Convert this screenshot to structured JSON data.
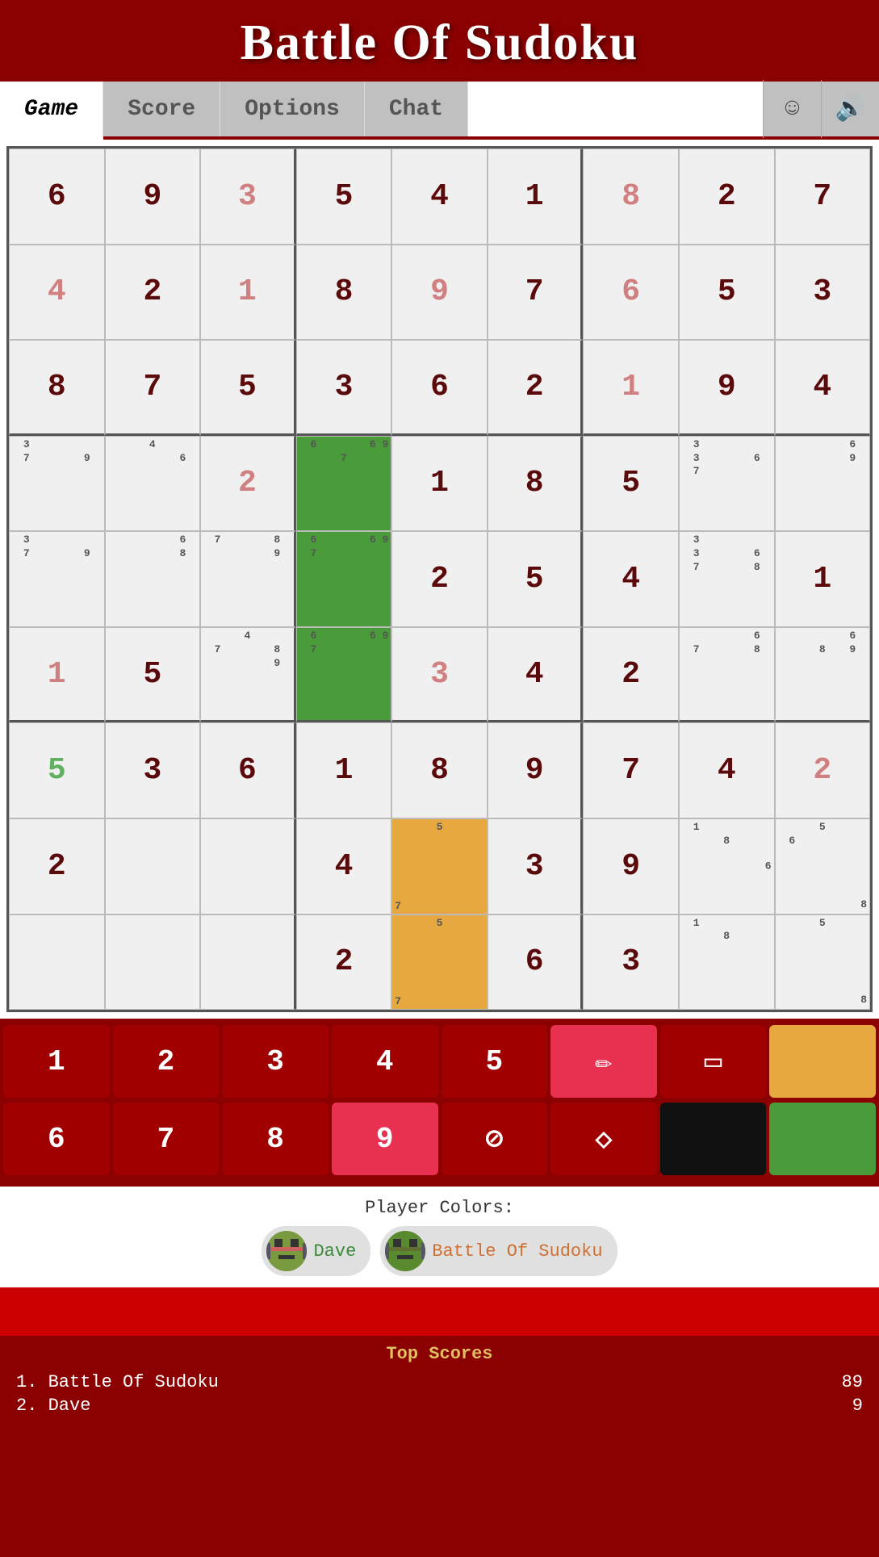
{
  "header": {
    "title": "Battle Of Sudoku"
  },
  "nav": {
    "tabs": [
      "Game",
      "Score",
      "Options",
      "Chat"
    ],
    "active_tab": "Game"
  },
  "grid": {
    "cells": [
      {
        "row": 0,
        "col": 0,
        "value": "6",
        "type": "fixed"
      },
      {
        "row": 0,
        "col": 1,
        "value": "9",
        "type": "fixed"
      },
      {
        "row": 0,
        "col": 2,
        "value": "3",
        "type": "player",
        "color": "pink"
      },
      {
        "row": 0,
        "col": 3,
        "value": "5",
        "type": "fixed"
      },
      {
        "row": 0,
        "col": 4,
        "value": "4",
        "type": "fixed"
      },
      {
        "row": 0,
        "col": 5,
        "value": "1",
        "type": "fixed"
      },
      {
        "row": 0,
        "col": 6,
        "value": "8",
        "type": "player",
        "color": "pink"
      },
      {
        "row": 0,
        "col": 7,
        "value": "2",
        "type": "fixed"
      },
      {
        "row": 0,
        "col": 8,
        "value": "7",
        "type": "fixed"
      },
      {
        "row": 1,
        "col": 0,
        "value": "4",
        "type": "player",
        "color": "pink"
      },
      {
        "row": 1,
        "col": 1,
        "value": "2",
        "type": "fixed"
      },
      {
        "row": 1,
        "col": 2,
        "value": "1",
        "type": "player",
        "color": "pink"
      },
      {
        "row": 1,
        "col": 3,
        "value": "8",
        "type": "fixed"
      },
      {
        "row": 1,
        "col": 4,
        "value": "9",
        "type": "player",
        "color": "pink"
      },
      {
        "row": 1,
        "col": 5,
        "value": "7",
        "type": "fixed"
      },
      {
        "row": 1,
        "col": 6,
        "value": "6",
        "type": "player",
        "color": "pink"
      },
      {
        "row": 1,
        "col": 7,
        "value": "5",
        "type": "fixed"
      },
      {
        "row": 1,
        "col": 8,
        "value": "3",
        "type": "fixed"
      },
      {
        "row": 2,
        "col": 0,
        "value": "8",
        "type": "fixed"
      },
      {
        "row": 2,
        "col": 1,
        "value": "7",
        "type": "fixed"
      },
      {
        "row": 2,
        "col": 2,
        "value": "5",
        "type": "fixed"
      },
      {
        "row": 2,
        "col": 3,
        "value": "3",
        "type": "fixed"
      },
      {
        "row": 2,
        "col": 4,
        "value": "6",
        "type": "fixed"
      },
      {
        "row": 2,
        "col": 5,
        "value": "2",
        "type": "fixed"
      },
      {
        "row": 2,
        "col": 6,
        "value": "1",
        "type": "player",
        "color": "pink"
      },
      {
        "row": 2,
        "col": 7,
        "value": "9",
        "type": "fixed"
      },
      {
        "row": 2,
        "col": 8,
        "value": "4",
        "type": "fixed"
      },
      {
        "row": 3,
        "col": 0,
        "value": "",
        "type": "notes",
        "notes": [
          "3",
          "",
          "",
          "7",
          "",
          "9",
          "",
          "",
          ""
        ]
      },
      {
        "row": 3,
        "col": 1,
        "value": "",
        "type": "notes",
        "notes": [
          "",
          "4",
          "",
          "",
          "",
          "6",
          "",
          "",
          ""
        ]
      },
      {
        "row": 3,
        "col": 2,
        "value": "2",
        "type": "player",
        "color": "pink"
      },
      {
        "row": 3,
        "col": 3,
        "value": "",
        "type": "notes",
        "bg": "green",
        "notes": [
          "",
          "",
          "",
          "6",
          "",
          "",
          "",
          "7",
          ""
        ],
        "topnotes": "6 9"
      },
      {
        "row": 3,
        "col": 4,
        "value": "1",
        "type": "fixed"
      },
      {
        "row": 3,
        "col": 5,
        "value": "8",
        "type": "fixed"
      },
      {
        "row": 3,
        "col": 6,
        "value": "5",
        "type": "fixed"
      },
      {
        "row": 3,
        "col": 7,
        "value": "",
        "type": "notes",
        "notes": [
          "3",
          "",
          "",
          "3",
          "",
          "6",
          "7",
          "",
          ""
        ]
      },
      {
        "row": 3,
        "col": 8,
        "value": "",
        "type": "notes",
        "notes": [
          "",
          "",
          "",
          "",
          "",
          "6",
          "",
          "",
          "9"
        ]
      },
      {
        "row": 4,
        "col": 0,
        "value": "",
        "type": "notes",
        "notes": [
          "3",
          "",
          "",
          "7",
          "",
          "9",
          "",
          "",
          ""
        ]
      },
      {
        "row": 4,
        "col": 1,
        "value": "",
        "type": "notes",
        "notes": [
          "",
          "",
          "",
          "",
          "",
          "6",
          "",
          "",
          "8"
        ]
      },
      {
        "row": 4,
        "col": 2,
        "value": "",
        "type": "notes",
        "notes": [
          "",
          "",
          "",
          "7",
          "",
          "8",
          "",
          "",
          "9"
        ]
      },
      {
        "row": 4,
        "col": 3,
        "value": "",
        "type": "notes",
        "bg": "green",
        "notes": [
          "",
          "",
          "",
          "6",
          "",
          "",
          "7",
          "",
          ""
        ],
        "topnotes": "6 9"
      },
      {
        "row": 4,
        "col": 4,
        "value": "2",
        "type": "fixed"
      },
      {
        "row": 4,
        "col": 5,
        "value": "5",
        "type": "fixed"
      },
      {
        "row": 4,
        "col": 6,
        "value": "4",
        "type": "fixed"
      },
      {
        "row": 4,
        "col": 7,
        "value": "",
        "type": "notes",
        "notes": [
          "3",
          "",
          "",
          "3",
          "",
          "6",
          "7",
          "",
          "8"
        ]
      },
      {
        "row": 4,
        "col": 8,
        "value": "1",
        "type": "fixed"
      },
      {
        "row": 5,
        "col": 0,
        "value": "1",
        "type": "player",
        "color": "pink"
      },
      {
        "row": 5,
        "col": 1,
        "value": "5",
        "type": "fixed"
      },
      {
        "row": 5,
        "col": 2,
        "value": "",
        "type": "notes",
        "notes": [
          "",
          "4",
          "",
          "7",
          "",
          "8",
          "",
          "",
          "9"
        ]
      },
      {
        "row": 5,
        "col": 3,
        "value": "",
        "type": "notes",
        "bg": "green",
        "notes": [
          "",
          "",
          "",
          "6",
          "",
          "",
          "7",
          "",
          ""
        ],
        "topnotes": "6 9"
      },
      {
        "row": 5,
        "col": 4,
        "value": "3",
        "type": "player",
        "color": "pink"
      },
      {
        "row": 5,
        "col": 5,
        "value": "4",
        "type": "fixed"
      },
      {
        "row": 5,
        "col": 6,
        "value": "2",
        "type": "fixed"
      },
      {
        "row": 5,
        "col": 7,
        "value": "",
        "type": "notes",
        "notes": [
          "",
          "",
          "",
          "",
          "",
          "6",
          "7",
          "",
          "8"
        ]
      },
      {
        "row": 5,
        "col": 8,
        "value": "",
        "type": "notes",
        "notes": [
          "",
          "",
          "",
          "",
          "",
          "6",
          "",
          "8",
          "9"
        ]
      },
      {
        "row": 6,
        "col": 0,
        "value": "5",
        "type": "player",
        "color": "green"
      },
      {
        "row": 6,
        "col": 1,
        "value": "3",
        "type": "fixed"
      },
      {
        "row": 6,
        "col": 2,
        "value": "6",
        "type": "fixed"
      },
      {
        "row": 6,
        "col": 3,
        "value": "1",
        "type": "fixed"
      },
      {
        "row": 6,
        "col": 4,
        "value": "8",
        "type": "fixed"
      },
      {
        "row": 6,
        "col": 5,
        "value": "9",
        "type": "fixed"
      },
      {
        "row": 6,
        "col": 6,
        "value": "7",
        "type": "fixed"
      },
      {
        "row": 6,
        "col": 7,
        "value": "4",
        "type": "fixed"
      },
      {
        "row": 6,
        "col": 8,
        "value": "2",
        "type": "player",
        "color": "pink"
      },
      {
        "row": 7,
        "col": 0,
        "value": "2",
        "type": "fixed"
      },
      {
        "row": 7,
        "col": 1,
        "value": "",
        "type": "empty"
      },
      {
        "row": 7,
        "col": 2,
        "value": "",
        "type": "empty"
      },
      {
        "row": 7,
        "col": 3,
        "value": "4",
        "type": "fixed"
      },
      {
        "row": 7,
        "col": 4,
        "value": "",
        "type": "notes",
        "bg": "orange",
        "notes": [
          "",
          "",
          "",
          "",
          "5",
          "",
          "",
          "",
          ""
        ],
        "botnotes": "7"
      },
      {
        "row": 7,
        "col": 5,
        "value": "3",
        "type": "fixed"
      },
      {
        "row": 7,
        "col": 6,
        "value": "9",
        "type": "fixed"
      },
      {
        "row": 7,
        "col": 7,
        "value": "",
        "type": "notes",
        "notes": [
          "1",
          "",
          "",
          "",
          "",
          "",
          "",
          "8",
          ""
        ],
        "side": "6"
      },
      {
        "row": 7,
        "col": 8,
        "value": "",
        "type": "notes",
        "notes": [
          "",
          "",
          "",
          "",
          "5",
          "",
          "6",
          "",
          ""
        ],
        "side2": "8"
      },
      {
        "row": 8,
        "col": 0,
        "value": "",
        "type": "empty"
      },
      {
        "row": 8,
        "col": 1,
        "value": "",
        "type": "empty"
      },
      {
        "row": 8,
        "col": 2,
        "value": "",
        "type": "empty"
      },
      {
        "row": 8,
        "col": 3,
        "value": "2",
        "type": "fixed"
      },
      {
        "row": 8,
        "col": 4,
        "value": "",
        "type": "notes",
        "bg": "orange",
        "notes": [
          "",
          "",
          "",
          "",
          "5",
          "",
          "",
          "",
          ""
        ],
        "botnotes": "7"
      },
      {
        "row": 8,
        "col": 5,
        "value": "6",
        "type": "fixed"
      },
      {
        "row": 8,
        "col": 6,
        "value": "3",
        "type": "fixed"
      },
      {
        "row": 8,
        "col": 7,
        "value": "",
        "type": "notes",
        "notes": [
          "1",
          "",
          "",
          "",
          "",
          "",
          "",
          "8",
          ""
        ]
      },
      {
        "row": 8,
        "col": 8,
        "value": "",
        "type": "notes",
        "notes": [
          "",
          "",
          "",
          "",
          "5",
          "",
          "",
          "",
          ""
        ],
        "side2": "8"
      }
    ]
  },
  "toolbar": {
    "row1": [
      {
        "label": "1",
        "type": "num"
      },
      {
        "label": "2",
        "type": "num"
      },
      {
        "label": "3",
        "type": "num"
      },
      {
        "label": "4",
        "type": "num"
      },
      {
        "label": "5",
        "type": "num"
      },
      {
        "label": "✏",
        "type": "tool",
        "active": true
      },
      {
        "label": "▭",
        "type": "tool"
      },
      {
        "label": "■",
        "type": "color",
        "color": "orange"
      }
    ],
    "row2": [
      {
        "label": "6",
        "type": "num"
      },
      {
        "label": "7",
        "type": "num"
      },
      {
        "label": "8",
        "type": "num"
      },
      {
        "label": "9",
        "type": "num",
        "active": true
      },
      {
        "label": "⊘",
        "type": "tool"
      },
      {
        "label": "◇",
        "type": "tool"
      },
      {
        "label": "■",
        "type": "color",
        "color": "black"
      },
      {
        "label": "■",
        "type": "color",
        "color": "green"
      }
    ]
  },
  "players": {
    "label": "Player Colors:",
    "list": [
      {
        "name": "Dave",
        "name_color": "green",
        "avatar_color": "#6a8a30"
      },
      {
        "name": "Battle Of Sudoku",
        "name_color": "orange",
        "avatar_color": "#5a7a30"
      }
    ]
  },
  "scores": {
    "title": "Top Scores",
    "list": [
      {
        "rank": "1.",
        "name": "Battle Of Sudoku",
        "score": "89"
      },
      {
        "rank": "2.",
        "name": "Dave",
        "score": "9"
      }
    ]
  }
}
